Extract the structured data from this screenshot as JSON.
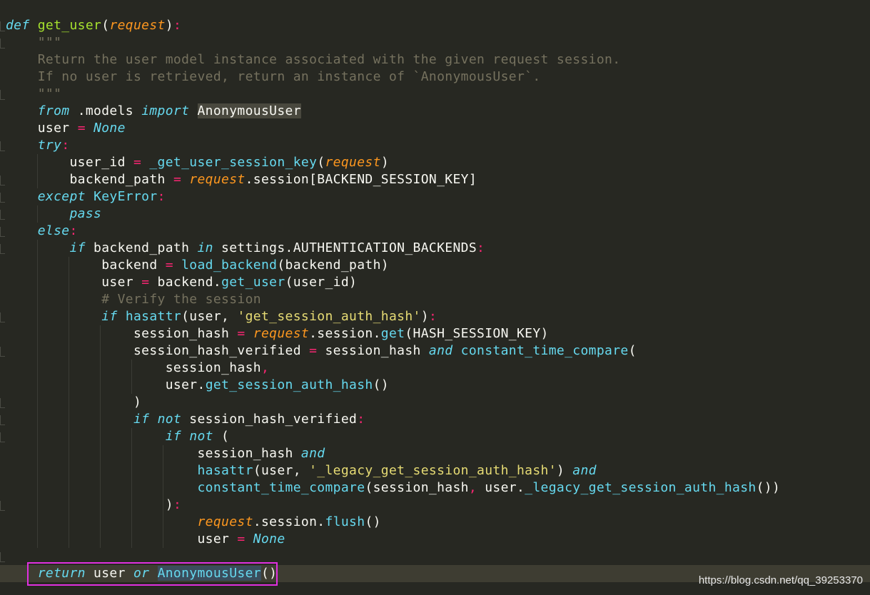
{
  "code": {
    "def_kw": "def",
    "func_name": "get_user",
    "param": "request",
    "docstring_open": "\"\"\"",
    "docstring_line1": "Return the user model instance associated with the given request session.",
    "docstring_line2": "If no user is retrieved, return an instance of `AnonymousUser`.",
    "docstring_close": "\"\"\"",
    "line_from": ".models",
    "anon_user": "AnonymousUser",
    "comment": "# Verify the session",
    "str_auth_hash": "'get_session_auth_hash'",
    "str_legacy": "'_legacy_get_session_auth_hash'"
  },
  "watermark": "https://blog.csdn.net/qq_39253370",
  "colors": {
    "background": "#272822",
    "keyword": "#66d9ef",
    "function": "#a6e22e",
    "parameter": "#fd971f",
    "string": "#e6db74",
    "comment": "#75715e",
    "operator": "#f92672",
    "highlight_box": "#e030e0"
  }
}
